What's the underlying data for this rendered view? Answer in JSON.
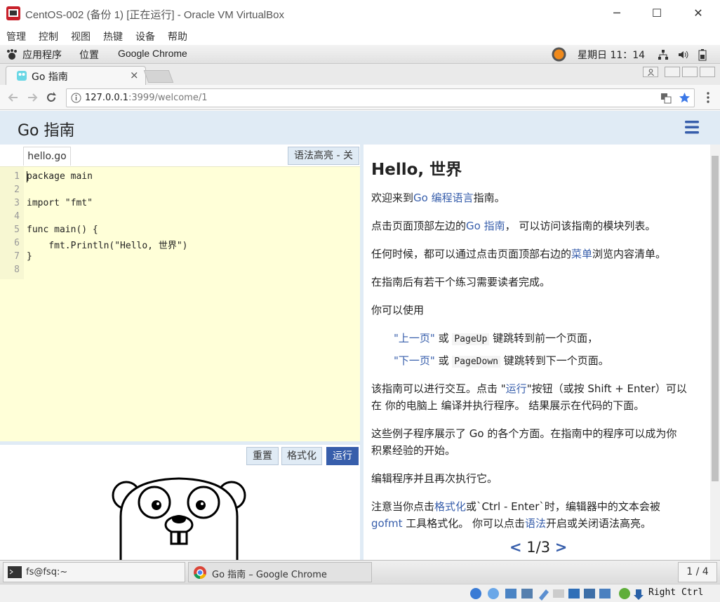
{
  "window": {
    "title": "CentOS-002 (备份 1) [正在运行] - Oracle VM VirtualBox",
    "minimize": "─",
    "maximize": "☐",
    "close": "✕"
  },
  "vbmenu": [
    "管理",
    "控制",
    "视图",
    "热键",
    "设备",
    "帮助"
  ],
  "gnome": {
    "apps": "应用程序",
    "places": "位置",
    "active_app": "Google Chrome",
    "clock": "星期日 11：14"
  },
  "chrome": {
    "tab_title": "Go 指南",
    "tab_close": "×",
    "url_host": "127.0.0.1",
    "url_rest": ":3999/welcome/1"
  },
  "header": {
    "title": "Go 指南",
    "menu_icon": "≡"
  },
  "editor": {
    "file_tab": "hello.go",
    "syntax_toggle": "语法高亮 - 关",
    "line_numbers": [
      "1",
      "2",
      "3",
      "4",
      "5",
      "6",
      "7",
      "8"
    ],
    "lines": [
      "package main",
      "",
      "import \"fmt\"",
      "",
      "func main() {",
      "    fmt.Println(\"Hello, 世界\")",
      "}",
      ""
    ]
  },
  "buttons": {
    "reset": "重置",
    "format": "格式化",
    "run": "运行"
  },
  "content": {
    "title": "Hello, 世界",
    "p1_a": "欢迎来到",
    "p1_link": "Go 编程语言",
    "p1_b": "指南。",
    "p2_a": "点击页面顶部左边的",
    "p2_link": "Go 指南",
    "p2_b": "， 可以访问该指南的模块列表。",
    "p3_a": "任何时候，都可以通过点击页面顶部右边的",
    "p3_link": "菜单",
    "p3_b": "浏览内容清单。",
    "p4": "在指南后有若干个练习需要读者完成。",
    "p5": "你可以使用",
    "li1_link": "\"上一页\"",
    "li1_a": " 或 ",
    "li1_kbd": "PageUp",
    "li1_b": " 键跳转到前一个页面，",
    "li2_link": "\"下一页\"",
    "li2_a": " 或 ",
    "li2_kbd": "PageDown",
    "li2_b": " 键跳转到下一个页面。",
    "p6_a": "该指南可以进行交互。点击 \"",
    "p6_link": "运行",
    "p6_b": "\"按钮（或按 Shift + Enter）可以",
    "p6_c": "在 你的电脑上 编译并执行程序。 结果展示在代码的下面。",
    "p7_a": "这些例子程序展示了 Go 的各个方面。在指南中的程序可以成为你",
    "p7_b": "积累经验的开始。",
    "p8": "编辑程序并且再次执行它。",
    "p9_a": "注意当你点击",
    "p9_link": "格式化",
    "p9_b": "或`Ctrl - Enter`时，编辑器中的文本会被",
    "p9_link2": "gofmt",
    "p9_c": " 工具格式化。 你可以点击",
    "p9_link3": "语法",
    "p9_d": "开启或关闭语法高亮。"
  },
  "pager": {
    "prev": "<",
    "page": "1/3",
    "next": ">"
  },
  "taskbar": {
    "terminal": "fs@fsq:~",
    "chrome": "Go 指南 – Google Chrome",
    "workspace": "1 / 4"
  },
  "vbstatus": {
    "hostkey": "Right Ctrl"
  }
}
